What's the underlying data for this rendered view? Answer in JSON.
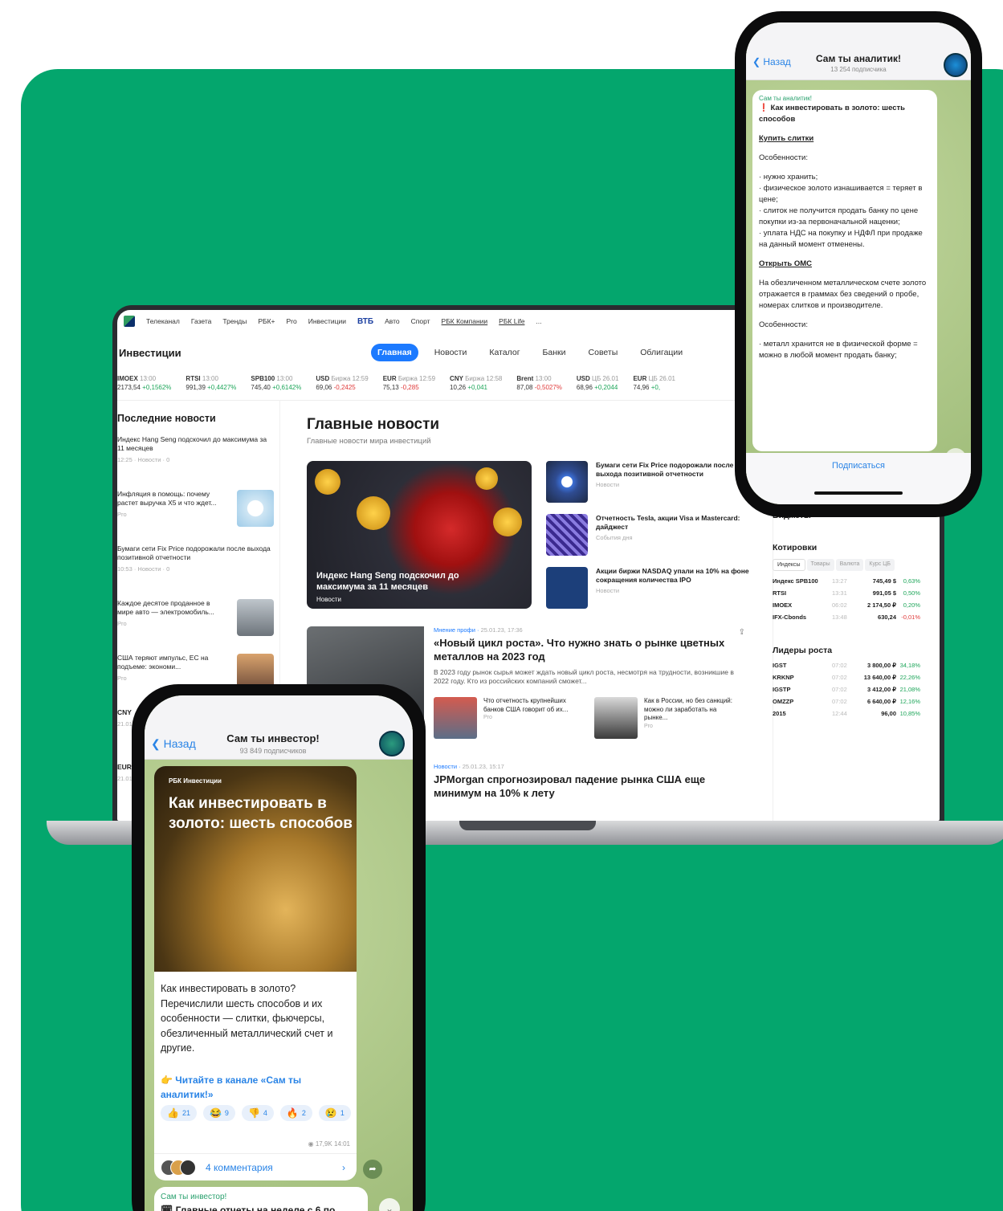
{
  "laptop": {
    "topnav": [
      "Телеканал",
      "Газета",
      "Тренды",
      "РБК+",
      "Pro",
      "Инвестиции",
      "ВТБ",
      "Авто",
      "Спорт",
      "РБК Компании",
      "РБК Life",
      "..."
    ],
    "section_title": "Инвестиции",
    "tabs": [
      "Главная",
      "Новости",
      "Каталог",
      "Банки",
      "Советы",
      "Облигации"
    ],
    "ticker": [
      {
        "name": "IMOEX",
        "time": "13:00",
        "value": "2173,54",
        "change": "+0,1562%",
        "dir": "up"
      },
      {
        "name": "RTSI",
        "time": "13:00",
        "value": "991,39",
        "change": "+0,4427%",
        "dir": "up"
      },
      {
        "name": "SPB100",
        "time": "13:00",
        "value": "745,40",
        "change": "+0,6142%",
        "dir": "up"
      },
      {
        "name": "USD",
        "time": "Биржа 12:59",
        "value": "69,06",
        "change": "-0,2425",
        "dir": "down"
      },
      {
        "name": "EUR",
        "time": "Биржа 12:59",
        "value": "75,13",
        "change": "-0,285",
        "dir": "down"
      },
      {
        "name": "CNY",
        "time": "Биржа 12:58",
        "value": "10,26",
        "change": "+0,041",
        "dir": "up"
      },
      {
        "name": "Brent",
        "time": "13:00",
        "value": "87,08",
        "change": "-0,5027%",
        "dir": "down"
      },
      {
        "name": "USD",
        "time": "ЦБ 26.01",
        "value": "68,96",
        "change": "+0,2044",
        "dir": "up"
      },
      {
        "name": "EUR",
        "time": "ЦБ 26.01",
        "value": "74,96",
        "change": "+0,",
        "dir": "up"
      }
    ],
    "latest": {
      "title": "Последние новости",
      "items": [
        {
          "text": "Индекс Hang Seng подскочил до максимума за 11 месяцев",
          "meta": "12:25 · Новости · 0",
          "thumb": false
        },
        {
          "text": "Инфляция в помощь: почему растет выручка X5 и что ждет...",
          "meta": "Pro",
          "thumb": true
        },
        {
          "text": "Бумаги сети Fix Price подорожали после выхода позитивной отчетности",
          "meta": "10:53 · Новости · 0",
          "thumb": false
        },
        {
          "text": "Каждое десятое проданное в мире авто — электромобиль...",
          "meta": "Pro",
          "thumb": true
        },
        {
          "text": "США теряют импульс, ЕС на подъеме: экономи...",
          "meta": "Pro",
          "thumb": true
        },
        {
          "text": "CNY",
          "meta": "21.01",
          "thumb": false
        },
        {
          "text": "EUR",
          "meta": "21.01",
          "thumb": false
        }
      ]
    },
    "main": {
      "title": "Главные новости",
      "subtitle": "Главные новости мира инвестиций",
      "hero": {
        "caption": "Индекс Hang Seng подскочил до максимума за 11 месяцев",
        "tag": "Новости"
      },
      "side": [
        {
          "text": "Бумаги сети Fix Price подорожали после выхода позитивной отчетности",
          "meta": "Новости"
        },
        {
          "text": "Отчетность Tesla, акции Visa и Mastercard: дайджест",
          "meta": "События дня"
        },
        {
          "text": "Акции биржи NASDAQ упали на 10% на фоне сокращения количества IPO",
          "meta": "Новости"
        }
      ],
      "article": {
        "kicker": "Мнение профи",
        "date": "25.01.23, 17:36",
        "title": "«Новый цикл роста». Что нужно знать о рынке цветных металлов на 2023 год",
        "lead": "В 2023 году рынок сырья может ждать новый цикл роста, несмотря на трудности, возникшие в 2022 году. Кто из российских компаний сможет...",
        "minis": [
          {
            "text": "Что отчетность крупнейших банков США говорит об их...",
            "meta": "Pro"
          },
          {
            "text": "Как в России, но без санкций: можно ли заработать на рынке...",
            "meta": "Pro"
          }
        ]
      },
      "article2": {
        "kicker": "Новости",
        "date": "25.01.23, 15:17",
        "title": "JPMorgan спрогнозировал падение рынка США еще минимум на 10% к лету"
      }
    },
    "right": {
      "widgets_title": "Виджеты",
      "quotes_title": "Котировки",
      "quote_tabs": [
        "Индексы",
        "Товары",
        "Валюта",
        "Курс ЦБ"
      ],
      "quotes": [
        {
          "name": "Индекс SPB100",
          "time": "13:27",
          "value": "745,49 $",
          "change": "0,63%"
        },
        {
          "name": "RTSI",
          "time": "13:31",
          "value": "991,05 $",
          "change": "0,50%"
        },
        {
          "name": "IMOEX",
          "time": "06:02",
          "value": "2 174,50 ₽",
          "change": "0,20%"
        },
        {
          "name": "IFX-Cbonds",
          "time": "13:48",
          "value": "630,24",
          "change": "-0,01%"
        }
      ],
      "leaders_title": "Лидеры роста",
      "leaders": [
        {
          "name": "IGST",
          "time": "07:02",
          "value": "3 800,00 ₽",
          "change": "34,18%"
        },
        {
          "name": "KRKNP",
          "time": "07:02",
          "value": "13 640,00 ₽",
          "change": "22,26%"
        },
        {
          "name": "IGSTP",
          "time": "07:02",
          "value": "3 412,00 ₽",
          "change": "21,08%"
        },
        {
          "name": "OMZZP",
          "time": "07:02",
          "value": "6 640,00 ₽",
          "change": "12,16%"
        },
        {
          "name": "2015",
          "time": "12:44",
          "value": "96,00",
          "change": "10,85%"
        }
      ]
    }
  },
  "phone_top": {
    "back": "Назад",
    "channel": "Сам ты аналитик!",
    "subscribers": "13 254 подписчика",
    "source": "Сам ты аналитик!",
    "heading": "❗ Как инвестировать в золото: шесть способов",
    "link1": "Купить слитки",
    "features_label": "Особенности:",
    "bullets1": "· нужно хранить;\n· физическое золото изнашивается = теряет в цене;\n· слиток не получится продать банку по цене покупки из-за первоначальной наценки;\n· уплата НДС на покупку и НДФЛ при продаже на данный момент отменены.",
    "link2": "Открыть ОМС",
    "oms_text": "На обезличенном металлическом счете золото отражается в граммах без сведений о пробе, номерах слитков и производителе.",
    "features_label2": "Особенности:",
    "bullets2": "· металл хранится не в физической форме = можно в любой момент продать банку;",
    "subscribe": "Подписаться"
  },
  "phone_bottom": {
    "back": "Назад",
    "channel": "Сам ты инвестор!",
    "subscribers": "93 849 подписчиков",
    "brand": "РБК Инвестиции",
    "title": "Как инвестировать в золото: шесть способов",
    "text": "Как инвестировать в золото? Перечислили шесть способов и их особенности — слитки, фьючерсы, обезличенный металлический счет и другие.",
    "link": "👉 Читайте в канале «Сам ты аналитик!»",
    "reactions": [
      {
        "emoji": "👍",
        "count": "21"
      },
      {
        "emoji": "😂",
        "count": "9"
      },
      {
        "emoji": "👎",
        "count": "4"
      },
      {
        "emoji": "🔥",
        "count": "2"
      },
      {
        "emoji": "😢",
        "count": "1"
      }
    ],
    "views": "17,9K 14:01",
    "comments": "4 комментария",
    "post2_source": "Сам ты инвестор!",
    "post2_text": "🗓 Главные отчеты на неделе с 6 по"
  }
}
